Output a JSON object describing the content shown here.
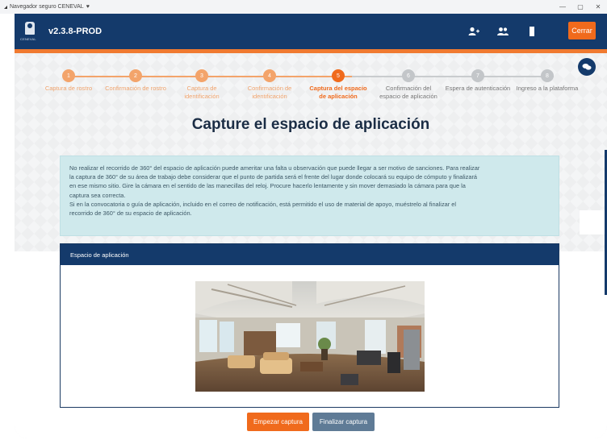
{
  "window": {
    "title": "Navegador seguro CENEVAL",
    "controls": [
      "—",
      "▢",
      "✕"
    ]
  },
  "header": {
    "logo_text": "CENEVAL",
    "version": "v2.3.8-PROD",
    "icons": [
      "user-plus-icon",
      "users-icon",
      "bookmark-icon"
    ],
    "close_label": "Cerrar"
  },
  "stepper": {
    "steps": [
      {
        "number": "1",
        "label": [
          "Captura de rostro"
        ],
        "state": "done"
      },
      {
        "number": "2",
        "label": [
          "Confirmación de rostro"
        ],
        "state": "done"
      },
      {
        "number": "3",
        "label": [
          "Captura de",
          "identificación"
        ],
        "state": "done"
      },
      {
        "number": "4",
        "label": [
          "Confirmación de",
          "identificación"
        ],
        "state": "done"
      },
      {
        "number": "5",
        "label": [
          "Captura del espacio",
          "de aplicación"
        ],
        "state": "current"
      },
      {
        "number": "6",
        "label": [
          "Confirmación del",
          "espacio de aplicación"
        ],
        "state": "todo"
      },
      {
        "number": "7",
        "label": [
          "Espera de autenticación"
        ],
        "state": "todo"
      },
      {
        "number": "8",
        "label": [
          "Ingreso a la plataforma"
        ],
        "state": "todo"
      }
    ]
  },
  "main": {
    "title": "Capture el espacio de aplicación",
    "info_lines": [
      "No realizar el recorrido de 360° del espacio de aplicación puede ameritar una falta u observación que puede llegar a ser motivo de sanciones. Para realizar",
      "la captura de 360° de su área de trabajo debe considerar que el punto de partida será el frente del lugar donde colocará su equipo de cómputo y finalizará",
      "en ese mismo sitio. Gire la cámara en el sentido de las manecillas del reloj. Procure hacerlo lentamente y sin mover demasiado la cámara para que la",
      "captura sea correcta.",
      "Si en la convocatoria o guía de aplicación, incluido en el correo de notificación, está permitido el uso de material de apoyo, muéstrelo al finalizar el",
      "recorrido de 360° de su espacio de aplicación."
    ],
    "panel_title": "Espacio de aplicación",
    "start_button": "Empezar captura",
    "finish_button": "Finalizar captura"
  },
  "colors": {
    "navy": "#143a6b",
    "orange": "#f06a1c",
    "done": "#f3a46b",
    "pending": "#c3c6c9",
    "info_bg": "#cfe9ec",
    "finish_btn": "#5f7b96"
  }
}
